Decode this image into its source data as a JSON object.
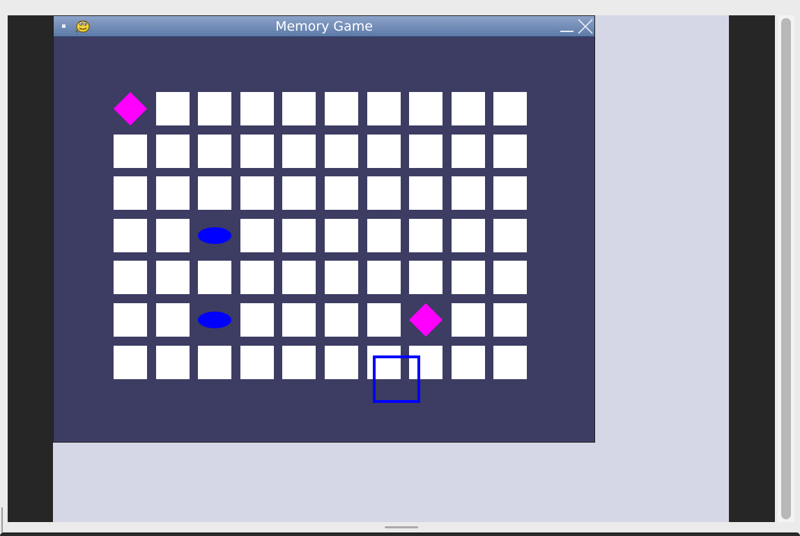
{
  "window": {
    "title": "Memory Game",
    "background_color": "#3d3c63",
    "titlebar_icons": [
      "menu-dot-icon",
      "pygame-snake-icon",
      "minimize-icon",
      "close-icon"
    ]
  },
  "board": {
    "rows": 7,
    "columns": 10,
    "tile_color": "#ffffff",
    "highlight_color": "#0000ff",
    "selected_tile": {
      "row": 7,
      "column": 6
    },
    "revealed_tiles": [
      {
        "row": 1,
        "column": 1,
        "shape": "diamond",
        "color": "#ff00ff"
      },
      {
        "row": 4,
        "column": 3,
        "shape": "oval",
        "color": "#0000ff"
      },
      {
        "row": 6,
        "column": 3,
        "shape": "oval",
        "color": "#0000ff"
      },
      {
        "row": 6,
        "column": 8,
        "shape": "diamond",
        "color": "#ff00ff"
      }
    ]
  }
}
